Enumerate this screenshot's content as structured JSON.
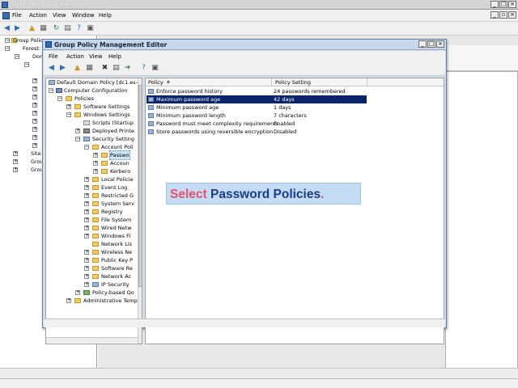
{
  "window": {
    "title": "Group Policy Management"
  },
  "main_menu": [
    "File",
    "Action",
    "View",
    "Window",
    "Help"
  ],
  "outer_tree": [
    "Group Policy",
    "Forest:",
    "Dom",
    "Site",
    "Grou",
    "Grou"
  ],
  "editor": {
    "title": "Group Policy Management Editor",
    "menu": [
      "File",
      "Action",
      "View",
      "Help"
    ],
    "tree": [
      {
        "label": "Default Domain Policy [dc1.es-n"
      },
      {
        "label": "Computer Configuration"
      },
      {
        "label": "Policies"
      },
      {
        "label": "Software Settings"
      },
      {
        "label": "Windows Settings"
      },
      {
        "label": "Scripts (Startup"
      },
      {
        "label": "Deployed Printe"
      },
      {
        "label": "Security Setting"
      },
      {
        "label": "Account Poli"
      },
      {
        "label": "Passwo"
      },
      {
        "label": "Accoun"
      },
      {
        "label": "Kerbero"
      },
      {
        "label": "Local Policie"
      },
      {
        "label": "Event Log"
      },
      {
        "label": "Restricted G"
      },
      {
        "label": "System Serv"
      },
      {
        "label": "Registry"
      },
      {
        "label": "File System"
      },
      {
        "label": "Wired Netw"
      },
      {
        "label": "Windows Fi"
      },
      {
        "label": "Network Lis"
      },
      {
        "label": "Wireless Ne"
      },
      {
        "label": "Public Key P"
      },
      {
        "label": "Software Re"
      },
      {
        "label": "Network Ac"
      },
      {
        "label": "IP Security"
      },
      {
        "label": "Policy-based Qo"
      },
      {
        "label": "Administrative Temp"
      }
    ],
    "columns": {
      "policy": "Policy",
      "setting": "Policy Setting"
    },
    "policies": [
      {
        "name": "Enforce password history",
        "setting": "24 passwords remembered"
      },
      {
        "name": "Maximum password age",
        "setting": "42 days"
      },
      {
        "name": "Minimum password age",
        "setting": "1 days"
      },
      {
        "name": "Minimum password length",
        "setting": "7 characters"
      },
      {
        "name": "Password must meet complexity requirements",
        "setting": "Enabled"
      },
      {
        "name": "Store passwords using reversible encryption",
        "setting": "Disabled"
      }
    ]
  },
  "callout": {
    "word1": "Select",
    "word2": "Password Policies",
    "dot": "."
  },
  "colors": {
    "callout_bg": "#c3dcf3",
    "accent_red": "#e94f6f",
    "accent_navy": "#1f3a8a",
    "selection": "#0a246a"
  }
}
